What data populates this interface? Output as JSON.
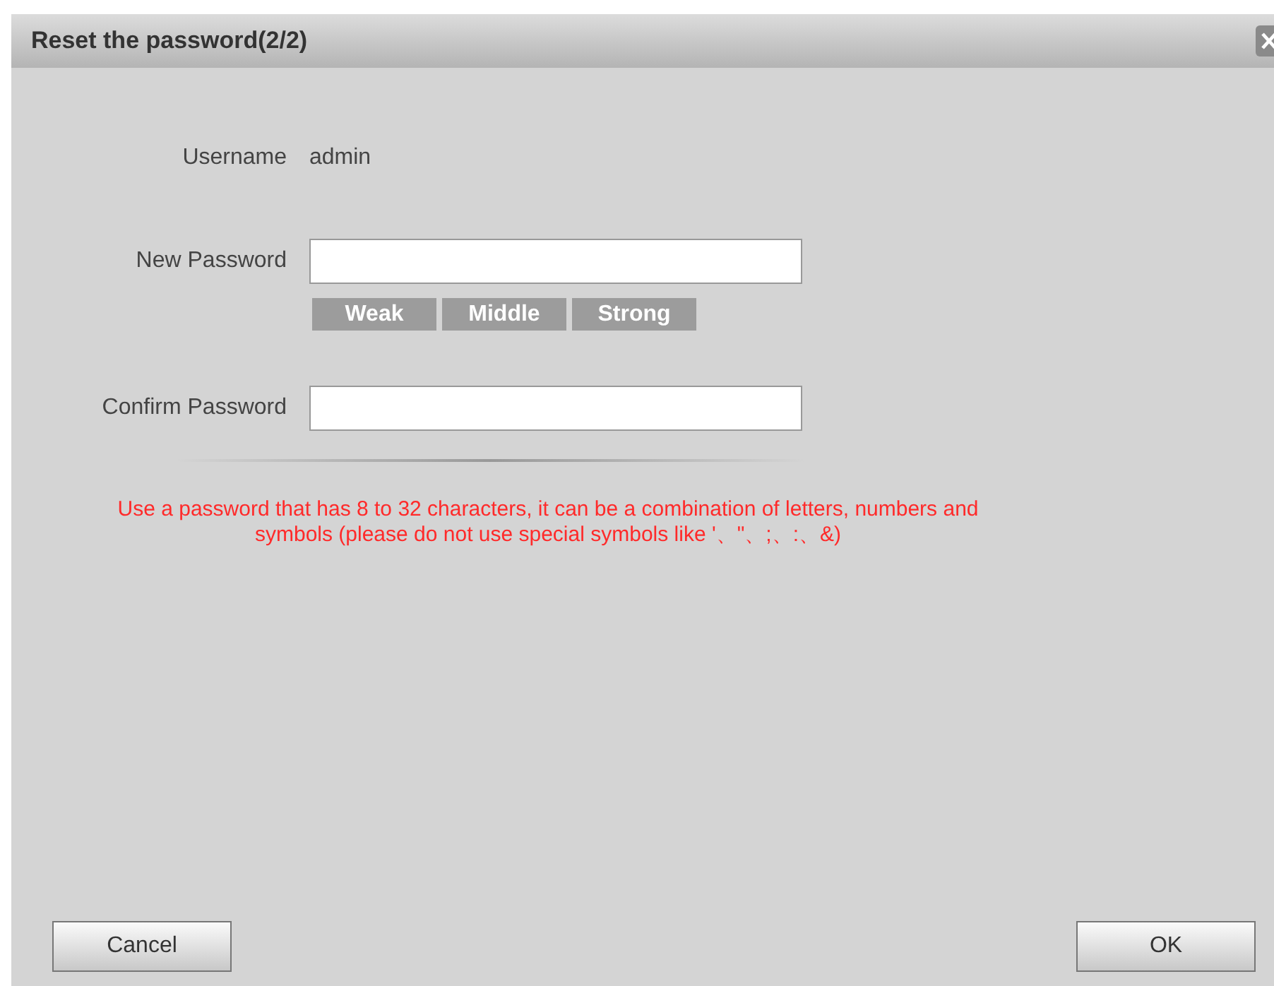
{
  "dialog": {
    "title": "Reset the password(2/2)"
  },
  "username": {
    "label": "Username",
    "value": "admin"
  },
  "new_password": {
    "label": "New Password"
  },
  "strength": [
    {
      "label": "Weak",
      "active": false
    },
    {
      "label": "Middle",
      "active": false
    },
    {
      "label": "Strong",
      "active": false
    }
  ],
  "confirm_password": {
    "label": "Confirm Password"
  },
  "hint": "Use a password that has 8 to 32 characters, it can be a combination of letters, numbers and symbols (please do not use special symbols like '、\"、;、:、&)",
  "buttons": {
    "cancel": "Cancel",
    "ok": "OK"
  }
}
